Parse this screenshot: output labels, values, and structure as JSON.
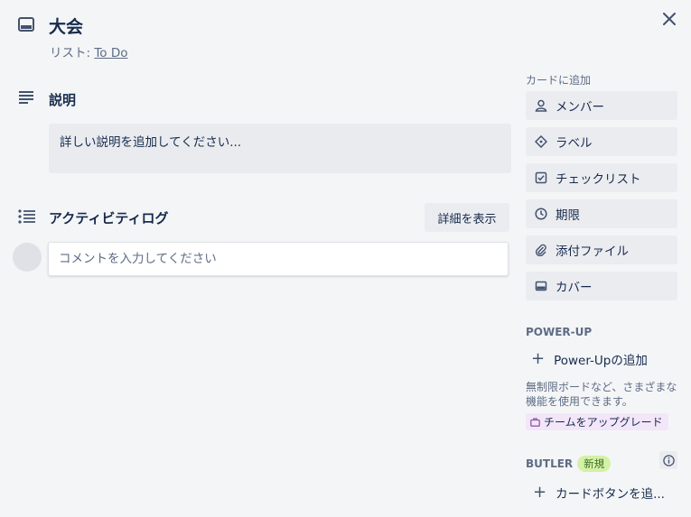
{
  "card": {
    "title": "大会",
    "list_prefix": "リスト: ",
    "list_name": "To Do"
  },
  "description": {
    "heading": "説明",
    "placeholder": "詳しい説明を追加してください..."
  },
  "activity": {
    "heading": "アクティビティログ",
    "details_button": "詳細を表示",
    "comment_placeholder": "コメントを入力してください"
  },
  "sidebar": {
    "add_to_card_heading": "カードに追加",
    "buttons": [
      {
        "label": "メンバー",
        "icon": "person-icon"
      },
      {
        "label": "ラベル",
        "icon": "label-icon"
      },
      {
        "label": "チェックリスト",
        "icon": "checklist-icon"
      },
      {
        "label": "期限",
        "icon": "clock-icon"
      },
      {
        "label": "添付ファイル",
        "icon": "paperclip-icon"
      },
      {
        "label": "カバー",
        "icon": "cover-icon"
      }
    ],
    "powerup_heading": "POWER-UP",
    "powerup_add": "Power-Upの追加",
    "powerup_note": "無制限ボードなど、さまざまな機能を使用できます。",
    "upgrade_label": "チームをアップグレード",
    "butler_heading": "BUTLER",
    "butler_badge": "新規",
    "card_button_add": "カードボタンを追..."
  },
  "colors": {
    "background": "#f4f5f7",
    "button_bg": "#ebecf0",
    "text": "#172b4d",
    "muted": "#5e6c84",
    "new_badge_bg": "#d3f1a7",
    "upgrade_bg": "#f3e6f9"
  }
}
